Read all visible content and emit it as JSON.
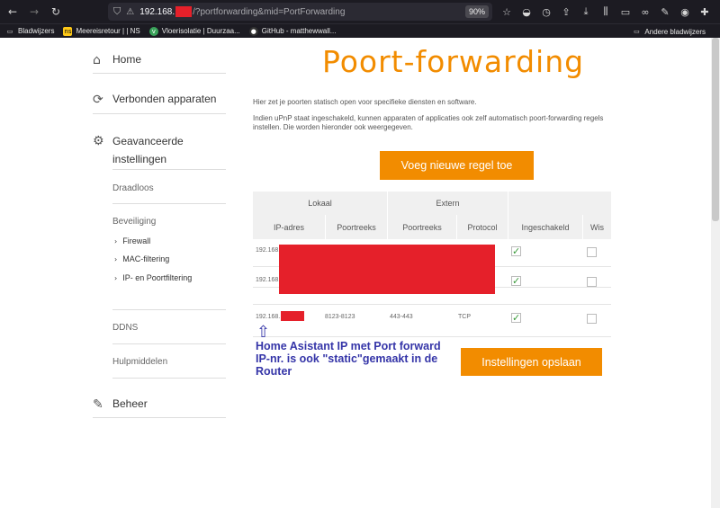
{
  "browser": {
    "url_host": "192.168.",
    "url_path": "/?portforwarding&mid=PortForwarding",
    "zoom": "90%",
    "bookmarks": [
      {
        "label": "Bladwijzers"
      },
      {
        "label": "Meereisretour | | NS"
      },
      {
        "label": "Vloerisolatie | Duurzaa..."
      },
      {
        "label": "GitHub - matthewwall..."
      }
    ],
    "other_bookmarks": "Andere bladwijzers"
  },
  "sidebar": {
    "home": "Home",
    "connected": "Verbonden apparaten",
    "advanced_1": "Geavanceerde",
    "advanced_2": "instellingen",
    "wireless": "Draadloos",
    "security": "Beveiliging",
    "firewall": "Firewall",
    "mac": "MAC-filtering",
    "ipport": "IP- en Poortfiltering",
    "ddns": "DDNS",
    "tools": "Hulpmiddelen",
    "manage": "Beheer"
  },
  "main": {
    "title": "Poort-forwarding",
    "para1": "Hier zet je poorten statisch open voor specifieke diensten en software.",
    "para2": "Indien uPnP staat ingeschakeld, kunnen apparaten of applicaties ook zelf automatisch poort-forwarding regels instellen. Die worden hieronder ook weergegeven.",
    "add_rule": "Voeg nieuwe regel toe",
    "save": "Instellingen opslaan"
  },
  "table": {
    "group_local": "Lokaal",
    "group_extern": "Extern",
    "col_ip": "IP-adres",
    "col_lport": "Poortreeks",
    "col_eport": "Poortreeks",
    "col_protocol": "Protocol",
    "col_enabled": "Ingeschakeld",
    "col_delete": "Wis",
    "rows": [
      {
        "ip": "192.168.",
        "lport": "",
        "eport": "",
        "protocol": "",
        "enabled": true
      },
      {
        "ip": "192.168.",
        "lport": "",
        "eport": "",
        "protocol": "",
        "enabled": true
      },
      {
        "ip": "192.168.",
        "lport": "8123-8123",
        "eport": "443-443",
        "protocol": "TCP",
        "enabled": true
      }
    ]
  },
  "annotation": {
    "line1": "Home Asistant IP met Port forward",
    "line2": "IP-nr. is ook \"static\"gemaakt in de",
    "line3": "Router"
  }
}
